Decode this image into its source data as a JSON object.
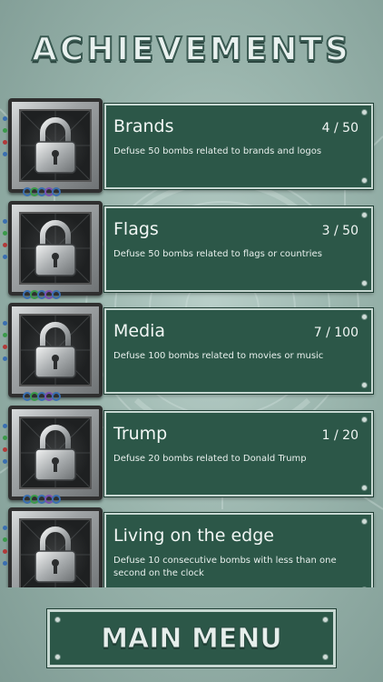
{
  "screen": {
    "title": "ACHIEVEMENTS",
    "accent_color": "#2c5748",
    "background_color": "#9ab5ad"
  },
  "achievements": [
    {
      "name": "Brands",
      "progress": "4 / 50",
      "description": "Defuse 50 bombs related to brands and logos",
      "icon": "padlock-icon",
      "locked": true
    },
    {
      "name": "Flags",
      "progress": "3 / 50",
      "description": "Defuse 50 bombs related to flags or countries",
      "icon": "padlock-icon",
      "locked": true
    },
    {
      "name": "Media",
      "progress": "7 / 100",
      "description": "Defuse 100 bombs related to movies or music",
      "icon": "padlock-icon",
      "locked": true
    },
    {
      "name": "Trump",
      "progress": "1 / 20",
      "description": "Defuse 20 bombs related to Donald Trump",
      "icon": "padlock-icon",
      "locked": true
    },
    {
      "name": "Living on the edge",
      "progress": "",
      "description": "Defuse 10 consecutive bombs with less than one second on the clock",
      "icon": "padlock-icon",
      "locked": true
    }
  ],
  "main_menu": {
    "label": "MAIN MENU"
  }
}
